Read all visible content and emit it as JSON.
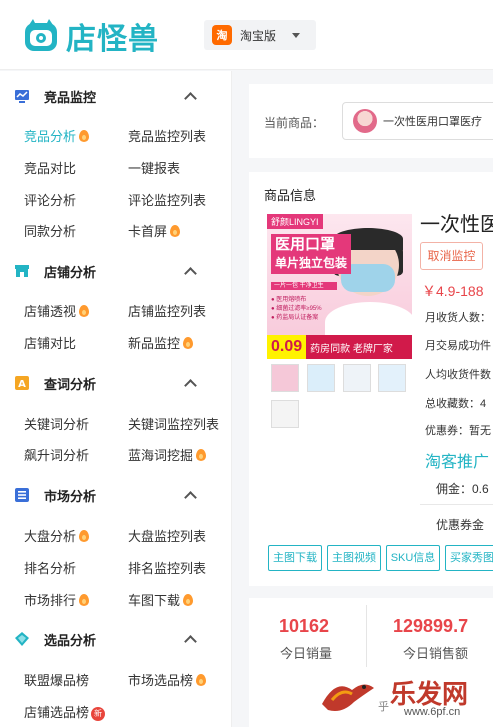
{
  "header": {
    "logo_text": "店怪兽",
    "platform": {
      "badge": "淘",
      "label": "淘宝版"
    }
  },
  "sidebar": {
    "sections": [
      {
        "title": "竞品监控",
        "icon": "monitor-chart-icon",
        "items": [
          {
            "label": "竞品分析",
            "hot": true,
            "active": true
          },
          {
            "label": "竞品监控列表"
          },
          {
            "label": "竞品对比"
          },
          {
            "label": "一键报表"
          },
          {
            "label": "评论分析"
          },
          {
            "label": "评论监控列表"
          },
          {
            "label": "同款分析"
          },
          {
            "label": "卡首屏",
            "hot": true
          }
        ]
      },
      {
        "title": "店铺分析",
        "icon": "shop-icon",
        "items": [
          {
            "label": "店铺透视",
            "hot": true
          },
          {
            "label": "店铺监控列表"
          },
          {
            "label": "店铺对比"
          },
          {
            "label": "新品监控",
            "hot": true
          }
        ]
      },
      {
        "title": "查词分析",
        "icon": "keyword-a-icon",
        "items": [
          {
            "label": "关键词分析"
          },
          {
            "label": "关键词监控列表"
          },
          {
            "label": "飙升词分析"
          },
          {
            "label": "蓝海词挖掘",
            "hot": true
          }
        ]
      },
      {
        "title": "市场分析",
        "icon": "list-icon",
        "items": [
          {
            "label": "大盘分析",
            "hot": true
          },
          {
            "label": "大盘监控列表"
          },
          {
            "label": "排名分析"
          },
          {
            "label": "排名监控列表"
          },
          {
            "label": "市场排行",
            "hot": true
          },
          {
            "label": "车图下载",
            "hot": true
          }
        ]
      },
      {
        "title": "选品分析",
        "icon": "diamond-icon",
        "items": [
          {
            "label": "联盟爆品榜"
          },
          {
            "label": "市场选品榜",
            "hot": true
          },
          {
            "label": "店铺选品榜",
            "new_badge": "新"
          }
        ]
      }
    ]
  },
  "main": {
    "current_label": "当前商品：",
    "current_product": "一次性医用口罩医疗",
    "info_title": "商品信息",
    "image": {
      "brand": "舒颜LINGYI",
      "headline1": "医用口罩",
      "headline2": "单片独立包装",
      "line1": "一片一包 干净卫生",
      "line2": "● 医用熔喷布",
      "line3": "● 细菌过滤率≥95%",
      "line4": "● 药监局认证备案",
      "price_tag": "0.09",
      "tagline": "药房同款 老牌厂家"
    },
    "product_title": "一次性医",
    "cancel_button": "取消监控",
    "price": "￥4.9-188",
    "meta": [
      "月收货人数：",
      "月交易成功件",
      "人均收货件数",
      "总收藏数：4",
      "优惠券：暂无"
    ],
    "promo": "淘客推广",
    "commission": "佣金：0.6",
    "coupon_amount": "优惠券金",
    "buttons": [
      "主图下载",
      "主图视频",
      "SKU信息",
      "买家秀图"
    ],
    "stats": [
      {
        "value": "10162",
        "label": "今日销量"
      },
      {
        "value": "129899.7",
        "label": "今日销售额"
      }
    ]
  },
  "watermark": {
    "brand": "乐发网",
    "url": "www.6pf.cn",
    "prefix": "乎"
  }
}
